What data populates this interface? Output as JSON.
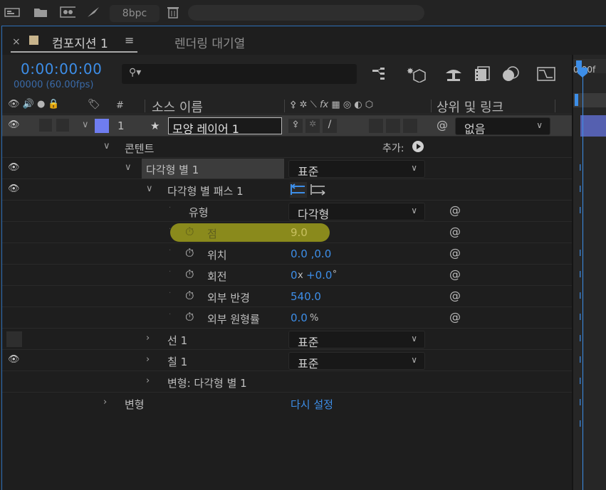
{
  "toolbar": {
    "icons": [
      "composition-icon",
      "folder-icon",
      "footage-icon",
      "render-icon",
      "trash-icon"
    ],
    "bpc_label": "8bpc"
  },
  "tabs": {
    "active_label": "컴포지션 1",
    "menu_glyph": "≡",
    "other_label": "렌더링 대기열"
  },
  "controls": {
    "timecode": "0:00:00:00",
    "frames": "00000 (60.00fps)",
    "search_placeholder": ""
  },
  "timeline": {
    "time_label": "0:00f"
  },
  "columns": {
    "number_label": "#",
    "source_name": "소스 이름",
    "fx_label": "fx",
    "parent_link": "상위 및 링크"
  },
  "layer": {
    "number": "1",
    "name": "모양 레이어 1",
    "label_color": "#6f7df0",
    "parent_value": "없음"
  },
  "rows": {
    "contents": "콘텐트",
    "add_label": "추가:",
    "polystar": "다각형 별 1",
    "polystar_mode": "표준",
    "polystar_path": "다각형 별 패스 1",
    "type_label": "유형",
    "type_value": "다각형",
    "points_label": "점",
    "points_value": "9.0",
    "position_label": "위치",
    "position_value": "0.0 ,0.0",
    "rotation_label": "회전",
    "rotation_value_a": "0",
    "rotation_x": "x",
    "rotation_value_b": "+0.0",
    "rotation_deg": "°",
    "outer_radius_label": "외부 반경",
    "outer_radius_value": "540.0",
    "outer_roundness_label": "외부 원형률",
    "outer_roundness_value": "0.0",
    "outer_roundness_unit": "%",
    "stroke_label": "선 1",
    "stroke_mode": "표준",
    "fill_label": "칠 1",
    "fill_mode": "표준",
    "transform_poly": "변형: 다각형 별 1",
    "transform": "변형",
    "reset": "다시 설정"
  },
  "colors": {
    "accent": "#3d8ee8",
    "highlight": "#9e9e1c"
  }
}
